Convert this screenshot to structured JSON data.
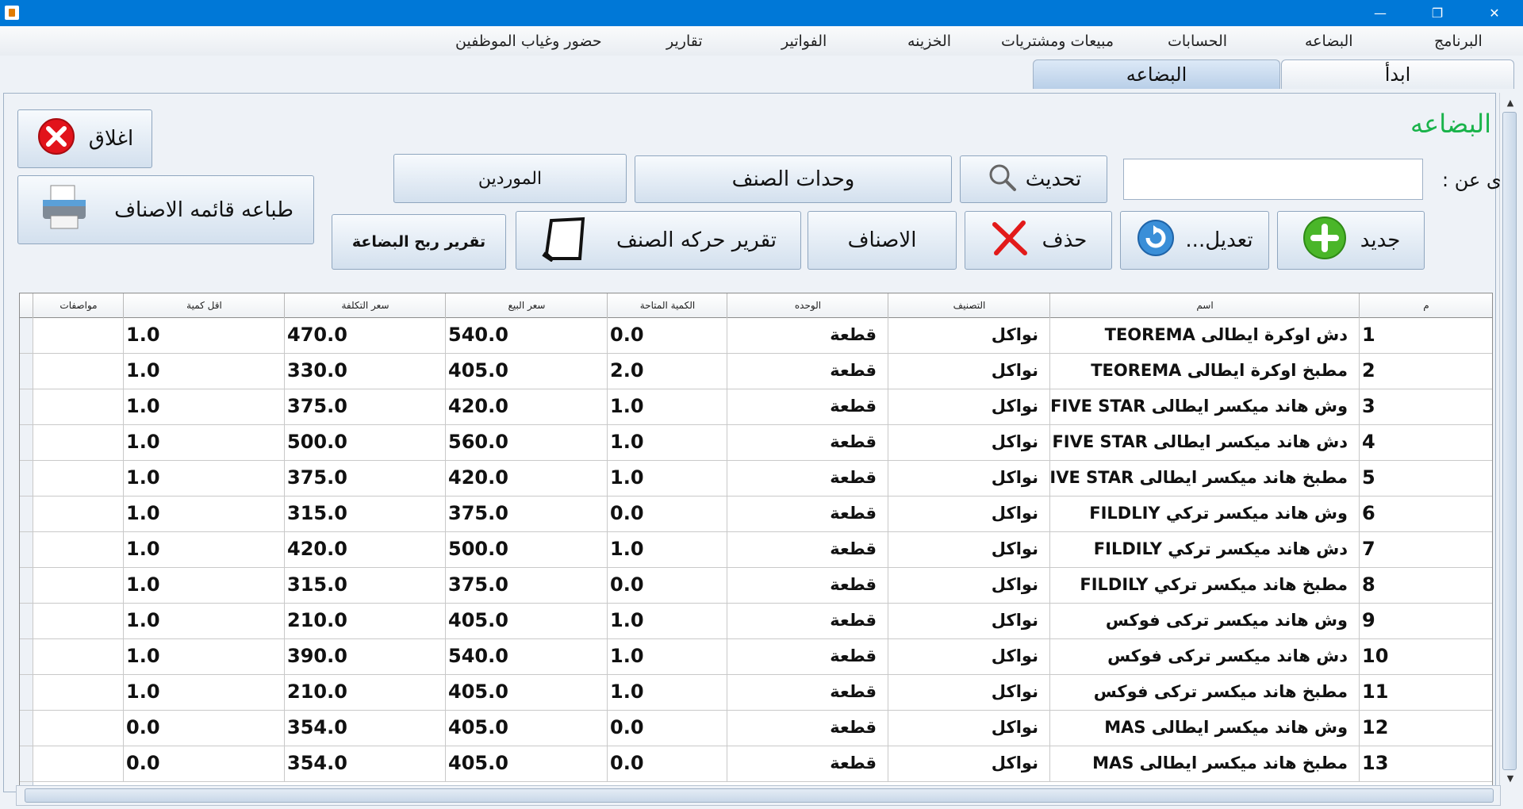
{
  "window": {
    "minimize_glyph": "—",
    "restore_glyph": "❐",
    "close_glyph": "✕"
  },
  "menu": [
    "البرنامج",
    "البضاعه",
    "الحسابات",
    "مبيعات ومشتريات",
    "الخزينه",
    "الفواتير",
    "تقارير",
    "حضور وغياب الموظفين"
  ],
  "tabs": {
    "start": "ابدأ",
    "goods": "البضاعه"
  },
  "section_title": "البضاعه",
  "search": {
    "label": "ى عن :",
    "value": ""
  },
  "buttons": {
    "close": "اغلاق",
    "print": "طباعه قائمه الاصناف",
    "suppliers": "الموردين",
    "units": "وحدات الصنف",
    "refresh": "تحديث",
    "profit_report": "تقرير ربح البضاعة",
    "movement_report": "تقرير حركه الصنف",
    "categories": "الاصناف",
    "delete": "حذف",
    "edit": "تعديل...",
    "new": "جديد"
  },
  "table": {
    "headers": {
      "num": "م",
      "name": "اسم",
      "category": "التصنيف",
      "unit": "الوحده",
      "qty": "الكمية المتاحة",
      "price": "سعر البيع",
      "cost": "سعر التكلفة",
      "min_qty": "اقل كمية",
      "specs": "مواصفات"
    },
    "rows": [
      {
        "num": "1",
        "name": "دش اوكرة ايطالى TEOREMA",
        "category": "نواكل",
        "unit": "قطعة",
        "qty": "0.0",
        "price": "540.0",
        "cost": "470.0",
        "min_qty": "1.0",
        "specs": ""
      },
      {
        "num": "2",
        "name": "مطبخ اوكرة ايطالى TEOREMA",
        "category": "نواكل",
        "unit": "قطعة",
        "qty": "2.0",
        "price": "405.0",
        "cost": "330.0",
        "min_qty": "1.0",
        "specs": ""
      },
      {
        "num": "3",
        "name": "وش هاند ميكسر ايطالى FIVE STAR",
        "category": "نواكل",
        "unit": "قطعة",
        "qty": "1.0",
        "price": "420.0",
        "cost": "375.0",
        "min_qty": "1.0",
        "specs": ""
      },
      {
        "num": "4",
        "name": "دش هاند ميكسر ايطالى FIVE STAR",
        "category": "نواكل",
        "unit": "قطعة",
        "qty": "1.0",
        "price": "560.0",
        "cost": "500.0",
        "min_qty": "1.0",
        "specs": ""
      },
      {
        "num": "5",
        "name": "مطبخ هاند ميكسر ايطالى FIVE STAR",
        "category": "نواكل",
        "unit": "قطعة",
        "qty": "1.0",
        "price": "420.0",
        "cost": "375.0",
        "min_qty": "1.0",
        "specs": ""
      },
      {
        "num": "6",
        "name": "وش هاند ميكسر تركي FILDLIY",
        "category": "نواكل",
        "unit": "قطعة",
        "qty": "0.0",
        "price": "375.0",
        "cost": "315.0",
        "min_qty": "1.0",
        "specs": ""
      },
      {
        "num": "7",
        "name": "دش هاند ميكسر تركي FILDILY",
        "category": "نواكل",
        "unit": "قطعة",
        "qty": "1.0",
        "price": "500.0",
        "cost": "420.0",
        "min_qty": "1.0",
        "specs": ""
      },
      {
        "num": "8",
        "name": "مطبخ هاند ميكسر تركي FILDILY",
        "category": "نواكل",
        "unit": "قطعة",
        "qty": "0.0",
        "price": "375.0",
        "cost": "315.0",
        "min_qty": "1.0",
        "specs": ""
      },
      {
        "num": "9",
        "name": "وش هاند ميكسر تركى فوكس",
        "category": "نواكل",
        "unit": "قطعة",
        "qty": "1.0",
        "price": "405.0",
        "cost": "210.0",
        "min_qty": "1.0",
        "specs": ""
      },
      {
        "num": "10",
        "name": "دش هاند ميكسر تركى فوكس",
        "category": "نواكل",
        "unit": "قطعة",
        "qty": "1.0",
        "price": "540.0",
        "cost": "390.0",
        "min_qty": "1.0",
        "specs": ""
      },
      {
        "num": "11",
        "name": "مطبخ هاند ميكسر تركى فوكس",
        "category": "نواكل",
        "unit": "قطعة",
        "qty": "1.0",
        "price": "405.0",
        "cost": "210.0",
        "min_qty": "1.0",
        "specs": ""
      },
      {
        "num": "12",
        "name": "وش هاند ميكسر ايطالى MAS",
        "category": "نواكل",
        "unit": "قطعة",
        "qty": "0.0",
        "price": "405.0",
        "cost": "354.0",
        "min_qty": "0.0",
        "specs": ""
      },
      {
        "num": "13",
        "name": "مطبخ هاند ميكسر ايطالى MAS",
        "category": "نواكل",
        "unit": "قطعة",
        "qty": "0.0",
        "price": "405.0",
        "cost": "354.0",
        "min_qty": "0.0",
        "specs": ""
      }
    ]
  }
}
